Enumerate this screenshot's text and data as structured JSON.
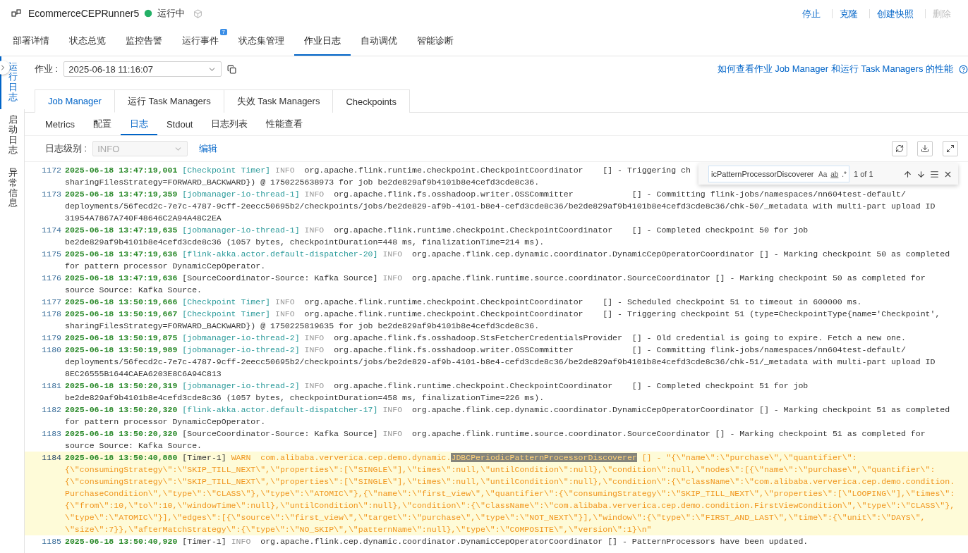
{
  "header": {
    "title": "EcommerceCEPRunner5",
    "status": "运行中",
    "actions": [
      {
        "label": "停止",
        "disabled": false
      },
      {
        "label": "克隆",
        "disabled": false
      },
      {
        "label": "创建快照",
        "disabled": false
      },
      {
        "label": "删除",
        "disabled": true
      }
    ]
  },
  "tabs": [
    {
      "label": "部署详情",
      "selected": false
    },
    {
      "label": "状态总览",
      "selected": false
    },
    {
      "label": "监控告警",
      "selected": false
    },
    {
      "label": "运行事件",
      "selected": false,
      "badge": "7"
    },
    {
      "label": "状态集管理",
      "selected": false
    },
    {
      "label": "作业日志",
      "selected": true
    },
    {
      "label": "自动调优",
      "selected": false
    },
    {
      "label": "智能诊断",
      "selected": false
    }
  ],
  "side_tabs": [
    {
      "label": "运行日志",
      "selected": true
    },
    {
      "label": "启动日志",
      "selected": false
    },
    {
      "label": "异常信息",
      "selected": false
    }
  ],
  "job": {
    "label": "作业 :",
    "value": "2025-06-18 11:16:07",
    "help_link": "如何查看作业 Job Manager 和运行 Task Managers 的性能"
  },
  "card_tabs": [
    {
      "label": "Job Manager",
      "selected": true
    },
    {
      "label": "运行 Task Managers",
      "selected": false
    },
    {
      "label": "失效 Task Managers",
      "selected": false
    },
    {
      "label": "Checkpoints",
      "selected": false
    }
  ],
  "sub_tabs": [
    {
      "label": "Metrics",
      "selected": false
    },
    {
      "label": "配置",
      "selected": false
    },
    {
      "label": "日志",
      "selected": true
    },
    {
      "label": "Stdout",
      "selected": false
    },
    {
      "label": "日志列表",
      "selected": false
    },
    {
      "label": "性能查看",
      "selected": false
    }
  ],
  "log_level": {
    "label": "日志级别 :",
    "value": "INFO",
    "disabled": true,
    "edit": "编辑"
  },
  "find": {
    "query": "icPatternProcessorDiscoverer",
    "case": "Aa",
    "word": "ab",
    "regex": ".*",
    "count": "1 of 1"
  },
  "log": [
    {
      "num": "1172",
      "time": "2025-06-18 13:47:19,001",
      "thread": "[Checkpoint Timer]",
      "color": "#2a9a9a",
      "level": "INFO",
      "kind": "info",
      "message": "org.apache.flink.runtime.checkpoint.CheckpointCoordinator    [] - Triggering ch",
      "continuation": [
        "sharingFilesStrategy=FORWARD_BACKWARD}) @ 1750225638973 for job be2de829af9b4101b8e4cefd3cde8c36."
      ]
    },
    {
      "num": "1173",
      "time": "2025-06-18 13:47:19,359",
      "thread": "[jobmanager-io-thread-1]",
      "color": "#2a9a9a",
      "level": "INFO",
      "kind": "info",
      "message": "org.apache.flink.fs.osshadoop.writer.OSSCommitter            [] - Committing flink-jobs/namespaces/nn604test-default/",
      "continuation": [
        "deployments/56fecd2c-7e7c-4787-9cff-2eecc50695b2/checkpoints/jobs/be2de829-af9b-4101-b8e4-cefd3cde8c36/be2de829af9b4101b8e4cefd3cde8c36/chk-50/_metadata with multi-part upload ID",
        "31954A7867A740F48646C2A94A48C2EA"
      ]
    },
    {
      "num": "1174",
      "time": "2025-06-18 13:47:19,635",
      "thread": "[jobmanager-io-thread-1]",
      "color": "#2a9a9a",
      "level": "INFO",
      "kind": "info",
      "message": "org.apache.flink.runtime.checkpoint.CheckpointCoordinator    [] - Completed checkpoint 50 for job",
      "continuation": [
        "be2de829af9b4101b8e4cefd3cde8c36 (1057 bytes, checkpointDuration=448 ms, finalizationTime=214 ms)."
      ]
    },
    {
      "num": "1175",
      "time": "2025-06-18 13:47:19,636",
      "thread": "[flink-akka.actor.default-dispatcher-20]",
      "color": "#2a9a9a",
      "level": "INFO",
      "kind": "info",
      "message": "org.apache.flink.cep.dynamic.coordinator.DynamicCepOperatorCoordinator [] - Marking checkpoint 50 as completed",
      "continuation": [
        "for pattern processor DynamicCepOperator."
      ]
    },
    {
      "num": "1176",
      "time": "2025-06-18 13:47:19,636",
      "thread": "[SourceCoordinator-Source: Kafka Source]",
      "color": "#333333",
      "level": "INFO",
      "kind": "info",
      "message": "org.apache.flink.runtime.source.coordinator.SourceCoordinator [] - Marking checkpoint 50 as completed for",
      "continuation": [
        "source Source: Kafka Source."
      ]
    },
    {
      "num": "1177",
      "time": "2025-06-18 13:50:19,666",
      "thread": "[Checkpoint Timer]",
      "color": "#2a9a9a",
      "level": "INFO",
      "kind": "info",
      "message": "org.apache.flink.runtime.checkpoint.CheckpointCoordinator    [] - Scheduled checkpoint 51 to timeout in 600000 ms."
    },
    {
      "num": "1178",
      "time": "2025-06-18 13:50:19,667",
      "thread": "[Checkpoint Timer]",
      "color": "#2a9a9a",
      "level": "INFO",
      "kind": "info",
      "message": "org.apache.flink.runtime.checkpoint.CheckpointCoordinator    [] - Triggering checkpoint 51 (type=CheckpointType{name='Checkpoint',",
      "continuation": [
        "sharingFilesStrategy=FORWARD_BACKWARD}) @ 1750225819635 for job be2de829af9b4101b8e4cefd3cde8c36."
      ]
    },
    {
      "num": "1179",
      "time": "2025-06-18 13:50:19,875",
      "thread": "[jobmanager-io-thread-2]",
      "color": "#2a9a9a",
      "level": "INFO",
      "kind": "info",
      "message": "org.apache.flink.fs.osshadoop.StsFetcherCredentialsProvider  [] - Old credential is going to expire. Fetch a new one."
    },
    {
      "num": "1180",
      "time": "2025-06-18 13:50:19,989",
      "thread": "[jobmanager-io-thread-2]",
      "color": "#2a9a9a",
      "level": "INFO",
      "kind": "info",
      "message": "org.apache.flink.fs.osshadoop.writer.OSSCommitter            [] - Committing flink-jobs/namespaces/nn604test-default/",
      "continuation": [
        "deployments/56fecd2c-7e7c-4787-9cff-2eecc50695b2/checkpoints/jobs/be2de829-af9b-4101-b8e4-cefd3cde8c36/be2de829af9b4101b8e4cefd3cde8c36/chk-51/_metadata with multi-part upload ID",
        "8EC26555B1644CAEA6203E8C6A94C813"
      ]
    },
    {
      "num": "1181",
      "time": "2025-06-18 13:50:20,319",
      "thread": "[jobmanager-io-thread-2]",
      "color": "#2a9a9a",
      "level": "INFO",
      "kind": "info",
      "message": "org.apache.flink.runtime.checkpoint.CheckpointCoordinator    [] - Completed checkpoint 51 for job",
      "continuation": [
        "be2de829af9b4101b8e4cefd3cde8c36 (1057 bytes, checkpointDuration=458 ms, finalizationTime=226 ms)."
      ]
    },
    {
      "num": "1182",
      "time": "2025-06-18 13:50:20,320",
      "thread": "[flink-akka.actor.default-dispatcher-17]",
      "color": "#2a9a9a",
      "level": "INFO",
      "kind": "info",
      "message": "org.apache.flink.cep.dynamic.coordinator.DynamicCepOperatorCoordinator [] - Marking checkpoint 51 as completed",
      "continuation": [
        "for pattern processor DynamicCepOperator."
      ]
    },
    {
      "num": "1183",
      "time": "2025-06-18 13:50:20,320",
      "thread": "[SourceCoordinator-Source: Kafka Source]",
      "color": "#333333",
      "level": "INFO",
      "kind": "info",
      "message": "org.apache.flink.runtime.source.coordinator.SourceCoordinator [] - Marking checkpoint 51 as completed for",
      "continuation": [
        "source Source: Kafka Source."
      ]
    },
    {
      "num": "1184",
      "time": "2025-06-18 13:50:40,880",
      "thread": "[Timer-1]",
      "color": "#333333",
      "level": "WARN",
      "kind": "warn",
      "message": "com.alibaba.ververica.cep.demo.dynamic.",
      "match": "JDBCPeriodicPatternProcessorDiscoverer",
      "message_after": " [] - \"{\\\"name\\\":\\\"purchase\\\",\\\"quantifier\\\":",
      "continuation": [
        "{\\\"consumingStrategy\\\":\\\"SKIP_TILL_NEXT\\\",\\\"properties\\\":[\\\"SINGLE\\\"],\\\"times\\\":null,\\\"untilCondition\\\":null},\\\"condition\\\":null,\\\"nodes\\\":[{\\\"name\\\":\\\"purchase\\\",\\\"quantifier\\\":",
        "{\\\"consumingStrategy\\\":\\\"SKIP_TILL_NEXT\\\",\\\"properties\\\":[\\\"SINGLE\\\"],\\\"times\\\":null,\\\"untilCondition\\\":null},\\\"condition\\\":{\\\"className\\\":\\\"com.alibaba.ververica.cep.demo.condition.",
        "PurchaseCondition\\\",\\\"type\\\":\\\"CLASS\\\"},\\\"type\\\":\\\"ATOMIC\\\"},{\\\"name\\\":\\\"first_view\\\",\\\"quantifier\\\":{\\\"consumingStrategy\\\":\\\"SKIP_TILL_NEXT\\\",\\\"properties\\\":[\\\"LOOPING\\\"],\\\"times\\\":",
        "{\\\"from\\\":10,\\\"to\\\":10,\\\"windowTime\\\":null},\\\"untilCondition\\\":null},\\\"condition\\\":{\\\"className\\\":\\\"com.alibaba.ververica.cep.demo.condition.FirstViewCondition\\\",\\\"type\\\":\\\"CLASS\\\"},",
        "\\\"type\\\":\\\"ATOMIC\\\"}],\\\"edges\\\":[{\\\"source\\\":\\\"first_view\\\",\\\"target\\\":\\\"purchase\\\",\\\"type\\\":\\\"NOT_NEXT\\\"}],\\\"window\\\":{\\\"type\\\":\\\"FIRST_AND_LAST\\\",\\\"time\\\":{\\\"unit\\\":\\\"DAYS\\\",",
        "\\\"size\\\":7}},\\\"afterMatchStrategy\\\":{\\\"type\\\":\\\"NO_SKIP\\\",\\\"patternName\\\":null},\\\"type\\\":\\\"COMPOSITE\\\",\\\"version\\\":1}\\n\""
      ]
    },
    {
      "num": "1185",
      "time": "2025-06-18 13:50:40,920",
      "thread": "[Timer-1]",
      "color": "#333333",
      "level": "INFO",
      "kind": "info",
      "message": "org.apache.flink.cep.dynamic.coordinator.DynamicCepOperatorCoordinator [] - PatternProcessors have been updated."
    }
  ]
}
